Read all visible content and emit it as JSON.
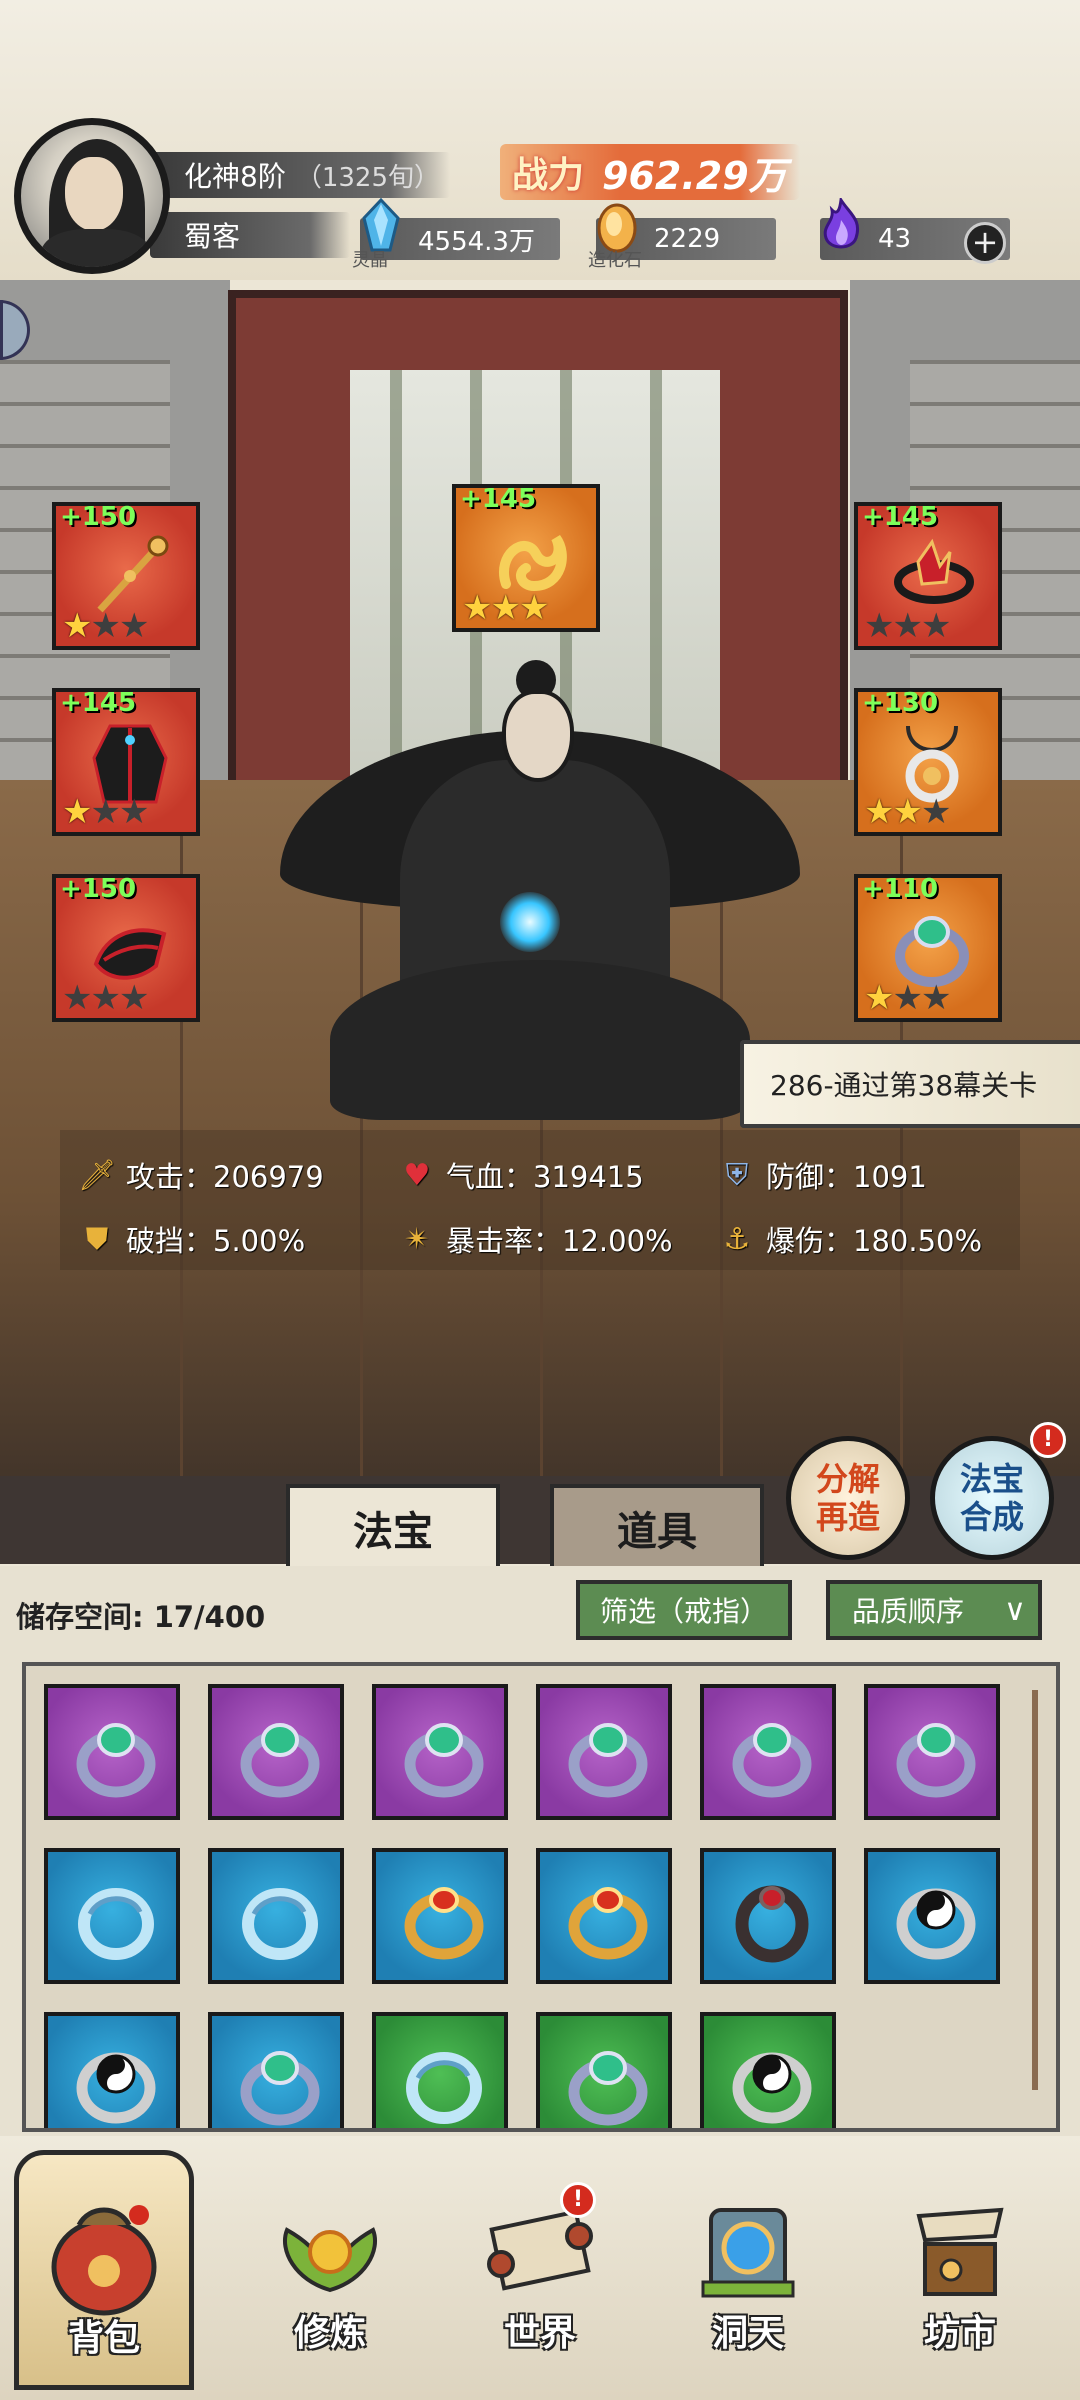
{
  "header": {
    "realm": "化神8阶",
    "age": "（1325旬）",
    "title": "蜀客",
    "power_label": "战力",
    "power_value": "962.29万",
    "resources": [
      {
        "icon": "spirit-crystal-icon",
        "caption": "灵晶",
        "value": "4554.3万"
      },
      {
        "icon": "creation-stone-icon",
        "caption": "造化石",
        "value": "2229"
      },
      {
        "icon": "purple-flame-icon",
        "caption": "",
        "value": "43"
      }
    ],
    "add_symbol": "+"
  },
  "equipment": [
    {
      "slot": "weapon",
      "plus": "+150",
      "stars": 1,
      "rarity": "red"
    },
    {
      "slot": "treasure",
      "plus": "+145",
      "stars": 3,
      "rarity": "orange"
    },
    {
      "slot": "headband",
      "plus": "+145",
      "stars": 0,
      "rarity": "red"
    },
    {
      "slot": "armor",
      "plus": "+145",
      "stars": 1,
      "rarity": "red"
    },
    {
      "slot": "necklace",
      "plus": "+130",
      "stars": 2,
      "rarity": "orange"
    },
    {
      "slot": "boots",
      "plus": "+150",
      "stars": 0,
      "rarity": "red"
    },
    {
      "slot": "ring",
      "plus": "+110",
      "stars": 1,
      "rarity": "orange"
    }
  ],
  "quest": "286-通过第38幕关卡",
  "stats": [
    {
      "icon": "sword-icon",
      "label": "攻击：206979"
    },
    {
      "icon": "heart-icon",
      "label": "气血：319415"
    },
    {
      "icon": "shield-icon",
      "label": "防御：1091"
    },
    {
      "icon": "shield-break-icon",
      "label": "破挡：5.00%"
    },
    {
      "icon": "crit-icon",
      "label": "暴击率：12.00%"
    },
    {
      "icon": "crit-damage-icon",
      "label": "爆伤：180.50%"
    }
  ],
  "actions": {
    "decompose_line1": "分解",
    "decompose_line2": "再造",
    "synth_line1": "法宝",
    "synth_line2": "合成",
    "badge": "!"
  },
  "tabs": {
    "fabao": "法宝",
    "daoju": "道具"
  },
  "inventory": {
    "storage_label": "储存空间: 17/400",
    "filter": "筛选（戒指）",
    "sort": "品质顺序",
    "sort_chevron": "∨",
    "items": [
      {
        "rarity": "purple",
        "icon": "jade-ring-icon"
      },
      {
        "rarity": "purple",
        "icon": "jade-ring-icon"
      },
      {
        "rarity": "purple",
        "icon": "jade-ring-icon"
      },
      {
        "rarity": "purple",
        "icon": "jade-ring-icon"
      },
      {
        "rarity": "purple",
        "icon": "jade-ring-icon"
      },
      {
        "rarity": "purple",
        "icon": "jade-ring-icon"
      },
      {
        "rarity": "blue",
        "icon": "dragon-ring-icon"
      },
      {
        "rarity": "blue",
        "icon": "dragon-ring-icon"
      },
      {
        "rarity": "blue",
        "icon": "gold-ruby-ring-icon"
      },
      {
        "rarity": "blue",
        "icon": "gold-ruby-ring-icon"
      },
      {
        "rarity": "blue",
        "icon": "dark-ruby-ring-icon"
      },
      {
        "rarity": "blue",
        "icon": "yinyang-ring-icon"
      },
      {
        "rarity": "blue",
        "icon": "yinyang-ring-icon"
      },
      {
        "rarity": "blue",
        "icon": "jade-ring-icon"
      },
      {
        "rarity": "green",
        "icon": "dragon-ring-icon"
      },
      {
        "rarity": "green",
        "icon": "jade-ring-icon"
      },
      {
        "rarity": "green",
        "icon": "yinyang-ring-icon"
      }
    ]
  },
  "nav": [
    {
      "label": "背包",
      "icon": "bag-icon",
      "badge": ""
    },
    {
      "label": "修炼",
      "icon": "lotus-icon",
      "badge": ""
    },
    {
      "label": "世界",
      "icon": "scroll-icon",
      "badge": "!"
    },
    {
      "label": "洞天",
      "icon": "portal-icon",
      "badge": ""
    },
    {
      "label": "坊市",
      "icon": "market-icon",
      "badge": ""
    }
  ],
  "colors": {
    "power": "#e46c3b",
    "plus": "#7dff5a",
    "star": "#ffd23e",
    "purple": "#8a3aa3",
    "blue": "#1f7fb3",
    "green": "#2c8c37"
  }
}
